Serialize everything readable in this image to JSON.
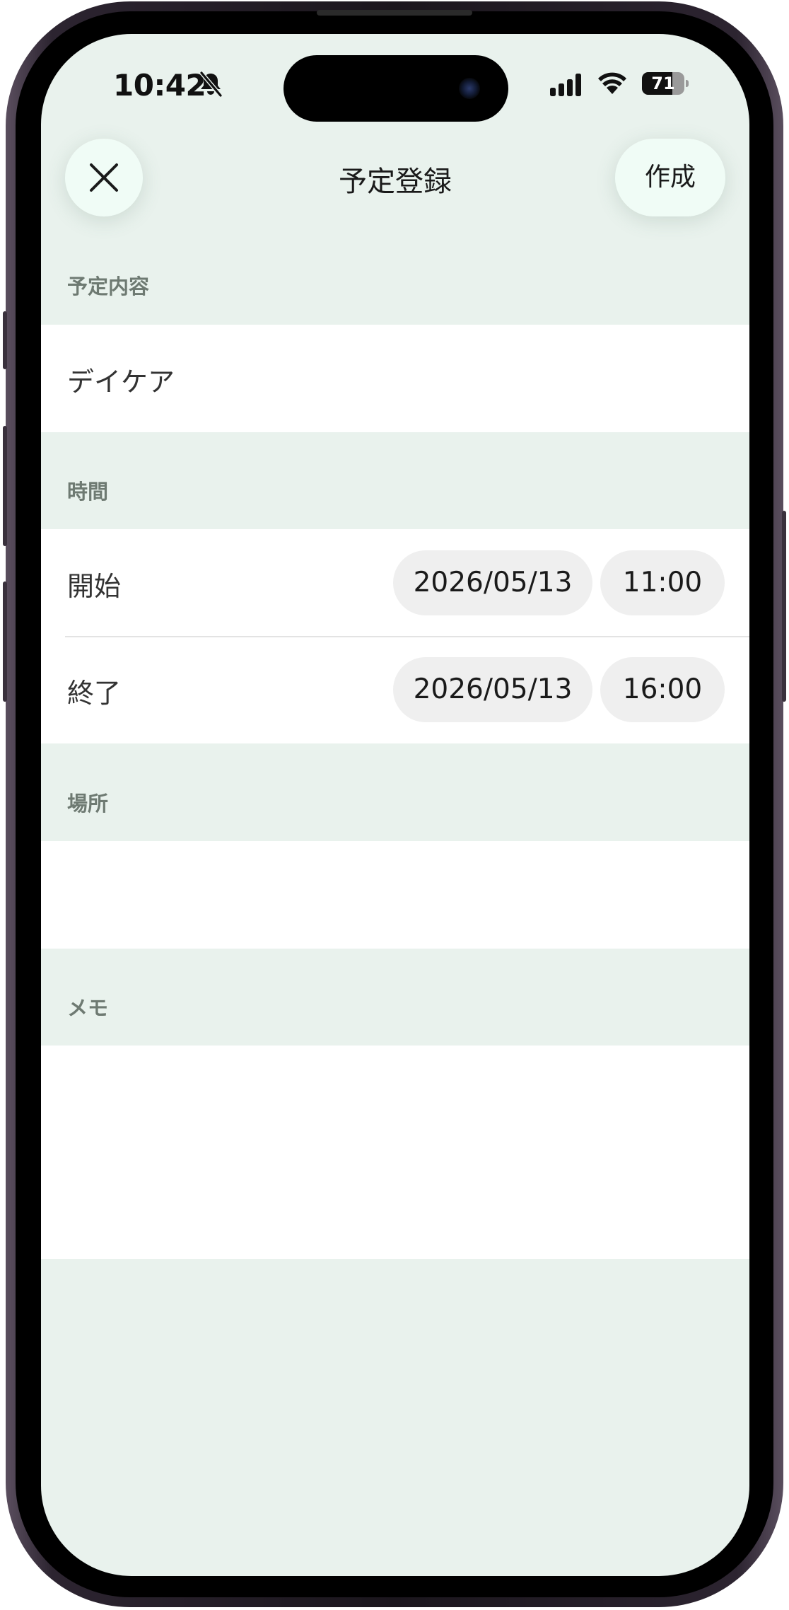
{
  "status_bar": {
    "time": "10:42",
    "battery_level": "71",
    "battery_fraction": 0.71
  },
  "nav": {
    "title": "予定登録",
    "create_label": "作成"
  },
  "sections": {
    "content": {
      "header": "予定内容",
      "value": "デイケア"
    },
    "time": {
      "header": "時間",
      "start_label": "開始",
      "start_date": "2026/05/13",
      "start_time": "11:00",
      "end_label": "終了",
      "end_date": "2026/05/13",
      "end_time": "16:00"
    },
    "place": {
      "header": "場所",
      "value": ""
    },
    "memo": {
      "header": "メモ",
      "value": ""
    }
  },
  "colors": {
    "background": "#e9f2ed",
    "button_bg": "#f0fcf6",
    "chip_bg": "#efefef",
    "section_header": "#6e7a72"
  },
  "icons": {
    "close": "close-icon",
    "bell_off": "bell-off-icon",
    "signal": "signal-icon",
    "wifi": "wifi-icon",
    "battery": "battery-icon"
  }
}
